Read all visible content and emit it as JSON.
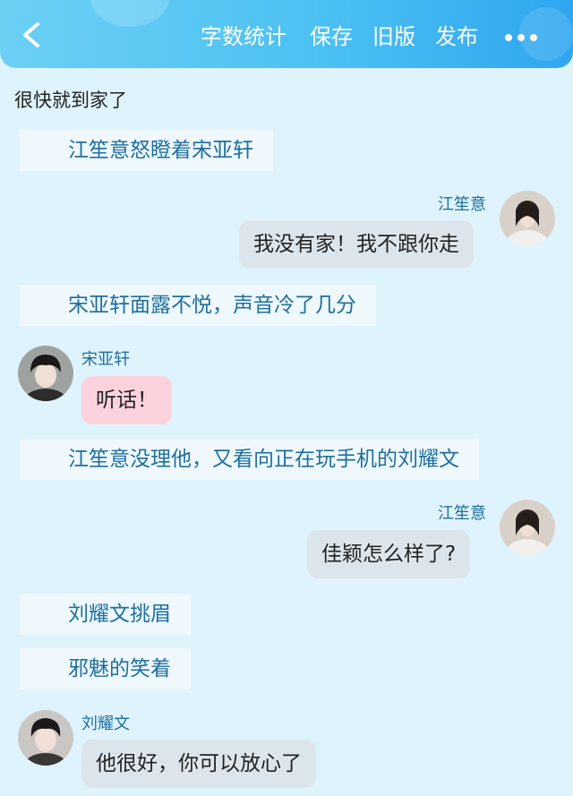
{
  "toolbar": {
    "actions": [
      "字数统计",
      "保存",
      "旧版",
      "发布"
    ],
    "icons": {
      "back": "chevron-left-icon",
      "more": "more-horizontal-icon"
    },
    "gradient": [
      "#6cd0f4",
      "#2fa6f0"
    ]
  },
  "story": {
    "opening_line": "很快就到家了",
    "narrations": [
      "江笙意怒瞪着宋亚轩",
      "宋亚轩面露不悦，声音冷了几分",
      "江笙意没理他，又看向正在玩手机的刘耀文",
      "刘耀文挑眉",
      "邪魅的笑着"
    ],
    "messages": [
      {
        "speaker": "江笙意",
        "text": "我没有家！我不跟你走",
        "side": "right",
        "bubble_color": "#dde5ec"
      },
      {
        "speaker": "宋亚轩",
        "text": "听话！",
        "side": "left",
        "bubble_color": "#fcd3dd"
      },
      {
        "speaker": "江笙意",
        "text": "佳颖怎么样了?",
        "side": "right",
        "bubble_color": "#dde5ec"
      },
      {
        "speaker": "刘耀文",
        "text": "他很好，你可以放心了",
        "side": "left",
        "bubble_color": "#dde5ec"
      }
    ]
  },
  "colors": {
    "background": "#dff3fc",
    "narration_text": "#1f6f9d",
    "narration_bg": "#eef8fd"
  }
}
